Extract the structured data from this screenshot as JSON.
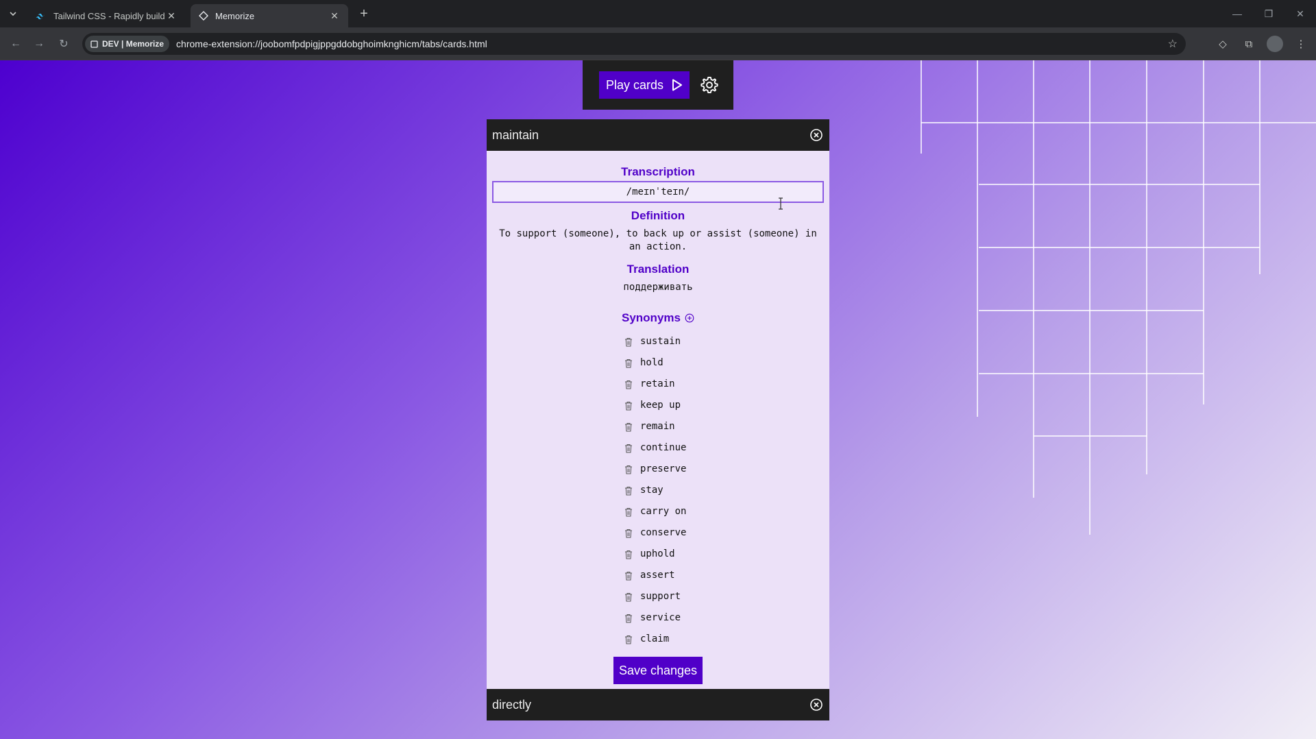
{
  "browser": {
    "tabs": [
      {
        "title": "Tailwind CSS - Rapidly build m",
        "active": false
      },
      {
        "title": "Memorize",
        "active": true
      }
    ],
    "site_chip": "DEV | Memorize",
    "url": "chrome-extension://joobomfpdpigjppgddobghoimknghicm/tabs/cards.html"
  },
  "controls": {
    "play_label": "Play cards"
  },
  "card": {
    "word": "maintain",
    "transcription_label": "Transcription",
    "transcription_value": "/meɪnˈteɪn/",
    "definition_label": "Definition",
    "definition": "To support (someone), to back up or assist (someone) in an action.",
    "translation_label": "Translation",
    "translation": "поддерживать",
    "synonyms_label": "Synonyms",
    "synonyms": [
      "sustain",
      "hold",
      "retain",
      "keep up",
      "remain",
      "continue",
      "preserve",
      "stay",
      "carry on",
      "conserve",
      "uphold",
      "assert",
      "support",
      "service",
      "claim"
    ],
    "save_label": "Save changes"
  },
  "next_card": {
    "word": "directly"
  },
  "colors": {
    "accent": "#5000c8",
    "header_bg": "#1f1f1f",
    "card_bg": "#ece1f8"
  }
}
